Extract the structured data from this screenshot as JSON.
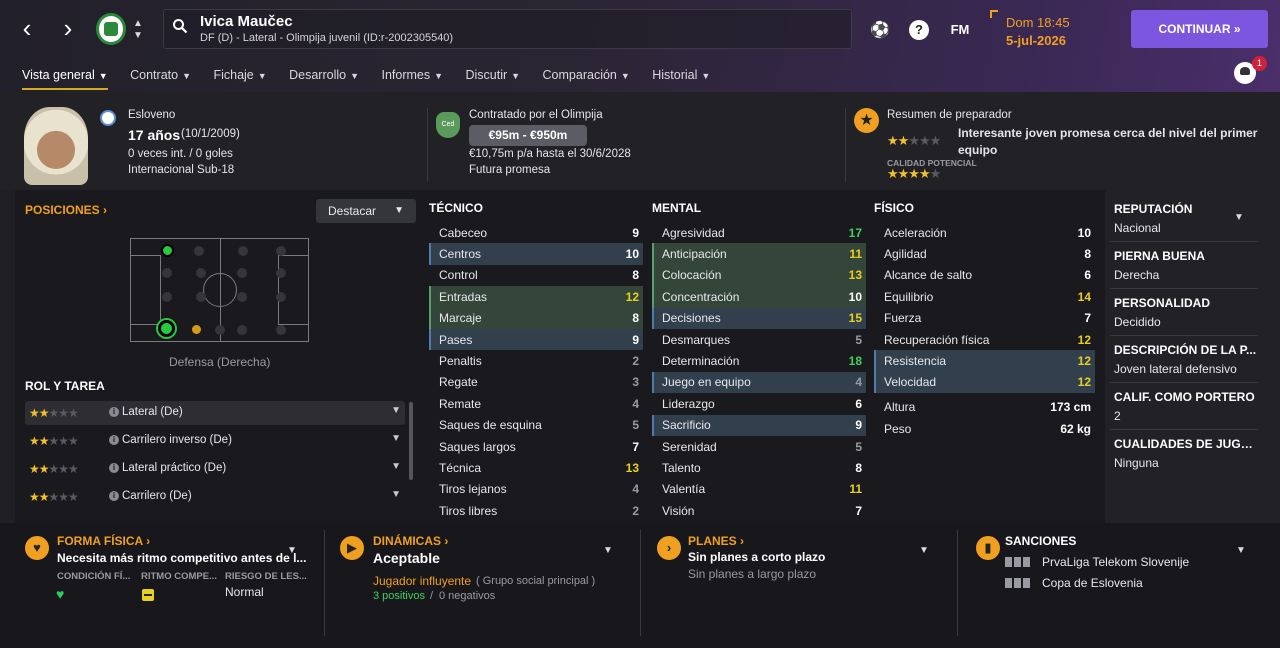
{
  "header": {
    "player_name": "Ivica Maučec",
    "player_sub": "DF (D) - Lateral - Olimpija juvenil (ID:r-2002305540)",
    "fm_label": "FM",
    "day_time": "Dom 18:45",
    "date": "5-jul-2026",
    "continue_label": "CONTINUAR",
    "notification_count": "1"
  },
  "tabs": [
    {
      "label": "Vista general",
      "active": true
    },
    {
      "label": "Contrato"
    },
    {
      "label": "Fichaje"
    },
    {
      "label": "Desarrollo"
    },
    {
      "label": "Informes"
    },
    {
      "label": "Discutir"
    },
    {
      "label": "Comparación"
    },
    {
      "label": "Historial"
    }
  ],
  "summary": {
    "nationality": "Esloveno",
    "age": "17 años",
    "dob": "(10/1/2009)",
    "caps": "0 veces int. / 0 goles",
    "intl": "Internacional Sub-18",
    "contract_badge": "Ced",
    "contracted_by": "Contratado por el Olimpija",
    "value": "€95m - €950m",
    "wage": "€10,75m p/a hasta el 30/6/2028",
    "status": "Futura promesa",
    "coach_title": "Resumen de preparador",
    "coach_text": "Interesante joven promesa cerca del nivel del primer equipo",
    "current_ability_stars": 2,
    "potential_label": "CALIDAD POTENCIAL",
    "potential_stars": 3.5
  },
  "positions": {
    "header": "POSICIONES",
    "highlight_label": "Destacar",
    "position_label": "Defensa (Derecha)"
  },
  "roles": {
    "header": "ROL Y TAREA",
    "items": [
      {
        "label": "Lateral (De)",
        "stars": 2
      },
      {
        "label": "Carrilero inverso (De)",
        "stars": 2
      },
      {
        "label": "Lateral práctico (De)",
        "stars": 2
      },
      {
        "label": "Carrilero (De)",
        "stars": 1.5
      }
    ]
  },
  "attributes": {
    "tecnico": {
      "header": "TÉCNICO",
      "rows": [
        {
          "name": "Cabeceo",
          "value": "9",
          "hl": "",
          "c": ""
        },
        {
          "name": "Centros",
          "value": "10",
          "hl": "blue",
          "c": ""
        },
        {
          "name": "Control",
          "value": "8",
          "hl": "",
          "c": ""
        },
        {
          "name": "Entradas",
          "value": "12",
          "hl": "green",
          "c": "y"
        },
        {
          "name": "Marcaje",
          "value": "8",
          "hl": "green",
          "c": ""
        },
        {
          "name": "Pases",
          "value": "9",
          "hl": "blue",
          "c": ""
        },
        {
          "name": "Penaltis",
          "value": "2",
          "hl": "",
          "c": "dim"
        },
        {
          "name": "Regate",
          "value": "3",
          "hl": "",
          "c": "dim"
        },
        {
          "name": "Remate",
          "value": "4",
          "hl": "",
          "c": "dim"
        },
        {
          "name": "Saques de esquina",
          "value": "5",
          "hl": "",
          "c": "dim"
        },
        {
          "name": "Saques largos",
          "value": "7",
          "hl": "",
          "c": ""
        },
        {
          "name": "Técnica",
          "value": "13",
          "hl": "",
          "c": "y"
        },
        {
          "name": "Tiros lejanos",
          "value": "4",
          "hl": "",
          "c": "dim"
        },
        {
          "name": "Tiros libres",
          "value": "2",
          "hl": "",
          "c": "dim"
        }
      ]
    },
    "mental": {
      "header": "MENTAL",
      "rows": [
        {
          "name": "Agresividad",
          "value": "17",
          "hl": "",
          "c": "g"
        },
        {
          "name": "Anticipación",
          "value": "11",
          "hl": "green",
          "c": "y"
        },
        {
          "name": "Colocación",
          "value": "13",
          "hl": "green",
          "c": "y"
        },
        {
          "name": "Concentración",
          "value": "10",
          "hl": "green",
          "c": ""
        },
        {
          "name": "Decisiones",
          "value": "15",
          "hl": "blue",
          "c": "y"
        },
        {
          "name": "Desmarques",
          "value": "5",
          "hl": "",
          "c": "dim"
        },
        {
          "name": "Determinación",
          "value": "18",
          "hl": "",
          "c": "g"
        },
        {
          "name": "Juego en equipo",
          "value": "4",
          "hl": "blue",
          "c": "dim"
        },
        {
          "name": "Liderazgo",
          "value": "6",
          "hl": "",
          "c": ""
        },
        {
          "name": "Sacrificio",
          "value": "9",
          "hl": "blue",
          "c": ""
        },
        {
          "name": "Serenidad",
          "value": "5",
          "hl": "",
          "c": "dim"
        },
        {
          "name": "Talento",
          "value": "8",
          "hl": "",
          "c": ""
        },
        {
          "name": "Valentía",
          "value": "11",
          "hl": "",
          "c": "y"
        },
        {
          "name": "Visión",
          "value": "7",
          "hl": "",
          "c": ""
        }
      ]
    },
    "fisico": {
      "header": "FÍSICO",
      "rows": [
        {
          "name": "Aceleración",
          "value": "10",
          "hl": "",
          "c": ""
        },
        {
          "name": "Agilidad",
          "value": "8",
          "hl": "",
          "c": ""
        },
        {
          "name": "Alcance de salto",
          "value": "6",
          "hl": "",
          "c": ""
        },
        {
          "name": "Equilibrio",
          "value": "14",
          "hl": "",
          "c": "y"
        },
        {
          "name": "Fuerza",
          "value": "7",
          "hl": "",
          "c": ""
        },
        {
          "name": "Recuperación física",
          "value": "12",
          "hl": "",
          "c": "y"
        },
        {
          "name": "Resistencia",
          "value": "12",
          "hl": "blue",
          "c": "y"
        },
        {
          "name": "Velocidad",
          "value": "12",
          "hl": "blue",
          "c": "y"
        }
      ],
      "height_label": "Altura",
      "height_value": "173 cm",
      "weight_label": "Peso",
      "weight_value": "62 kg"
    }
  },
  "info": [
    {
      "header": "REPUTACIÓN",
      "text": "Nacional"
    },
    {
      "header": "PIERNA BUENA",
      "text": "Derecha"
    },
    {
      "header": "PERSONALIDAD",
      "text": "Decidido"
    },
    {
      "header": "DESCRIPCIÓN DE LA P...",
      "text": "Joven lateral defensivo"
    },
    {
      "header": "CALIF. COMO PORTERO",
      "text": "2"
    },
    {
      "header": "CUALIDADES DE JUGADO",
      "text": "Ninguna"
    }
  ],
  "bottom": {
    "forma": {
      "header": "FORMA FÍSICA",
      "text": "Necesita más ritmo competitivo antes de l...",
      "col1": "CONDICIÓN FÍ...",
      "col2": "RITMO COMPE...",
      "col3": "RIESGO DE LES...",
      "risk": "Normal"
    },
    "dinamicas": {
      "header": "DINÁMICAS",
      "value": "Aceptable",
      "role": "Jugador influyente",
      "group": "( Grupo social principal )",
      "positives": "3 positivos",
      "slash": "/",
      "negatives": "0 negativos"
    },
    "planes": {
      "header": "PLANES",
      "short": "Sin planes a corto plazo",
      "long": "Sin planes a largo plazo"
    },
    "sanciones": {
      "header": "SANCIONES",
      "items": [
        "PrvaLiga Telekom Slovenije",
        "Copa de Eslovenia"
      ]
    }
  }
}
